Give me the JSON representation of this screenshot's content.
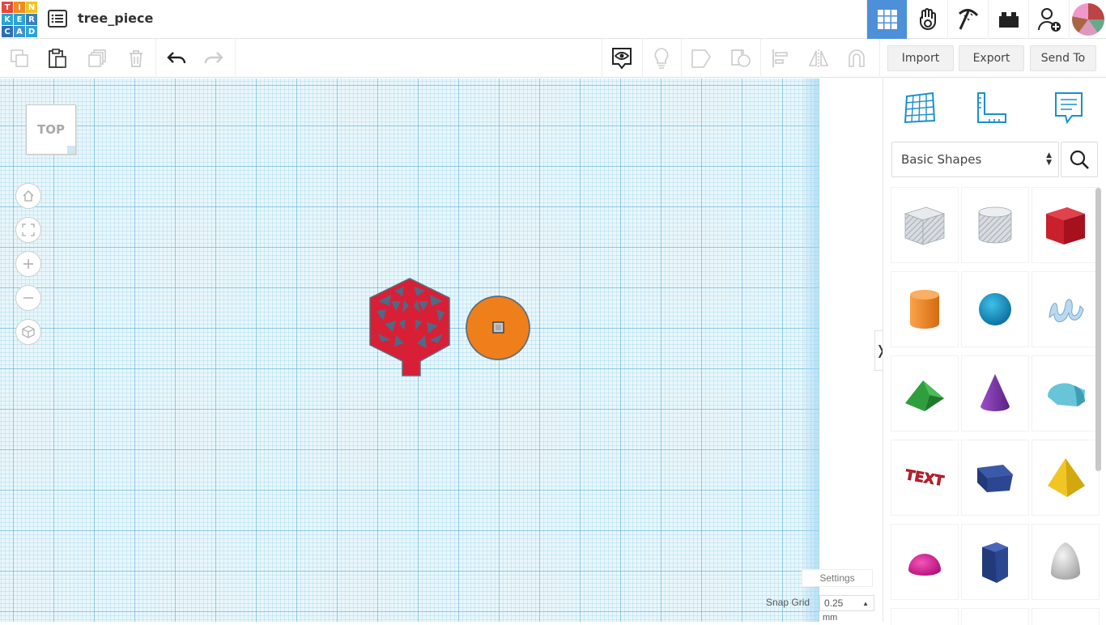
{
  "app": {
    "logo_letters": [
      "T",
      "I",
      "N",
      "K",
      "E",
      "R",
      "C",
      "A",
      "D"
    ],
    "logo_colors": [
      "#e8473d",
      "#f38b1f",
      "#f2c322",
      "#2aa4d8",
      "#2aa4d8",
      "#3a7fc4",
      "#2b6fb3",
      "#3b93cf",
      "#2aa4d8"
    ],
    "design_title": "tree_piece"
  },
  "topbar": {
    "icons": [
      "grid-view-icon",
      "tinker-hand-icon",
      "pickaxe-icon",
      "bricks-icon",
      "add-user-icon"
    ],
    "active_index": 0,
    "accent": "#4d8fd9"
  },
  "toolbar": {
    "import_label": "Import",
    "export_label": "Export",
    "send_to_label": "Send To"
  },
  "canvas": {
    "viewcube_label": "TOP",
    "settings_label": "Settings",
    "snap_label": "Snap Grid",
    "snap_value": "0.25",
    "snap_unit": "mm",
    "objects": [
      {
        "name": "tree-hexagon",
        "color": "#d91f35"
      },
      {
        "name": "orange-disc",
        "color": "#ef7f1a"
      }
    ]
  },
  "panel": {
    "library_label": "Basic Shapes",
    "collapse_glyph": "❭",
    "shapes": [
      "box-hole",
      "cylinder-hole",
      "box",
      "cylinder",
      "sphere",
      "scribble",
      "roof",
      "cone",
      "round-roof",
      "text",
      "half-box",
      "pyramid",
      "half-sphere",
      "polygon",
      "paraboloid"
    ]
  }
}
